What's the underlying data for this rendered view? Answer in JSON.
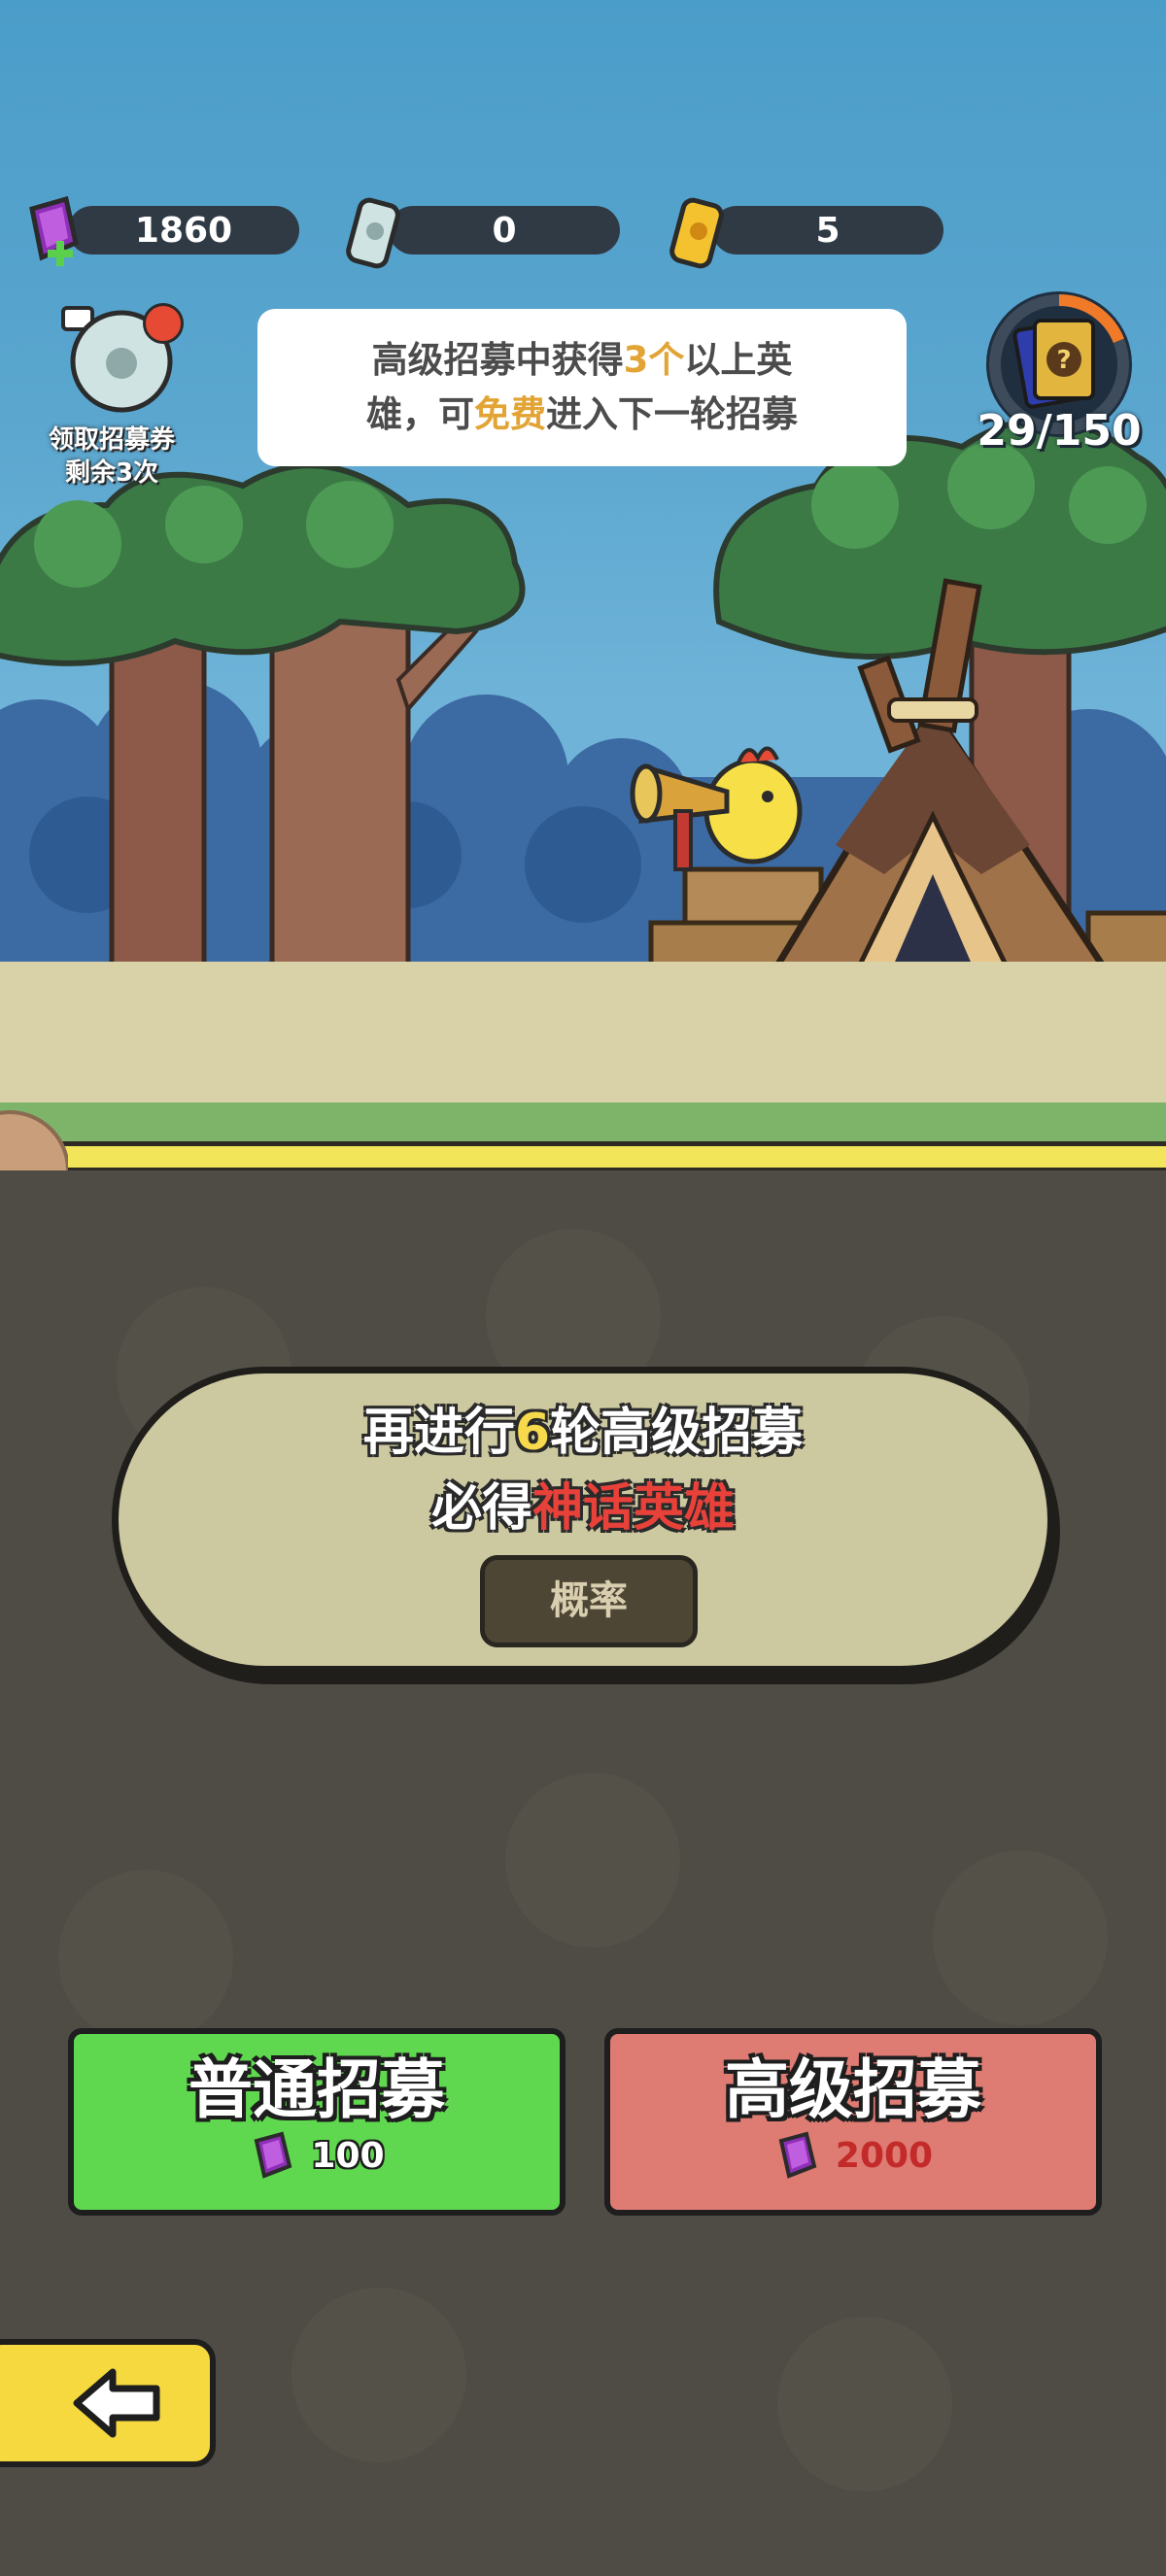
{
  "resources": [
    {
      "name": "gem",
      "value": "1860",
      "icon": "purple-gem-plus-icon"
    },
    {
      "name": "silver-ticket",
      "value": "0",
      "icon": "silver-ticket-icon"
    },
    {
      "name": "gold-ticket",
      "value": "5",
      "icon": "gold-ticket-icon"
    }
  ],
  "free_ticket": {
    "line1": "领取招募券",
    "line2": "剩余3次"
  },
  "tip": {
    "l1a": "高级招募中获得",
    "l1b": "3个",
    "l1c": "以上英",
    "l2a": "雄，可",
    "l2b": "免费",
    "l2c": "进入下一轮招募"
  },
  "hero_progress": {
    "text": "29/150",
    "fraction": 0.19
  },
  "info": {
    "l1a": "再进行",
    "l1b": "6",
    "l1c": "轮高级招募",
    "l2a": "必得",
    "l2b": "神话英雄",
    "prob_button": "概率"
  },
  "normal_recruit": {
    "title": "普通招募",
    "cost": "100",
    "color": "#5fd84f"
  },
  "advanced_recruit": {
    "title": "高级招募",
    "cost": "2000",
    "color": "#de7b72",
    "cost_color": "#c32a2a"
  }
}
